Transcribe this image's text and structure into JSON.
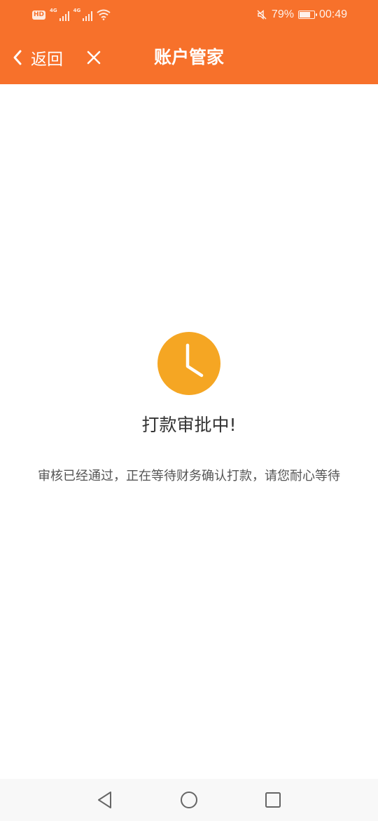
{
  "status_bar": {
    "hd": "HD",
    "sim1_network": "4G",
    "sim2_network": "4G",
    "battery_percent": "79%",
    "battery_level": 0.79,
    "time": "00:49"
  },
  "header": {
    "back_label": "返回",
    "title": "账户管家",
    "background": "#f7712b"
  },
  "main": {
    "status_icon": "clock-icon",
    "status_icon_color": "#f5a623",
    "status_title": "打款审批中!",
    "status_description": "审核已经通过，正在等待财务确认打款，请您耐心等待"
  },
  "system_nav": {
    "back_icon": "triangle-back-icon",
    "home_icon": "circle-home-icon",
    "recents_icon": "square-recents-icon"
  }
}
